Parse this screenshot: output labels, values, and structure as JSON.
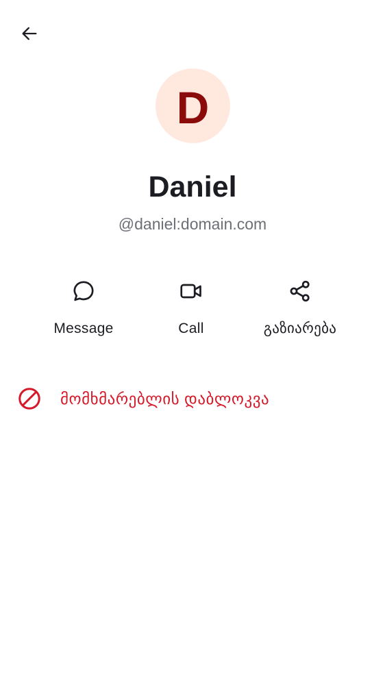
{
  "header": {
    "back_icon": "arrow-left-icon"
  },
  "profile": {
    "avatar_letter": "D",
    "display_name": "Daniel",
    "user_id": "@daniel:domain.com",
    "avatar_bg_color": "#ffe9df",
    "avatar_letter_color": "#8b0a0a"
  },
  "actions": [
    {
      "label": "Message",
      "icon": "chat-bubble-icon"
    },
    {
      "label": "Call",
      "icon": "video-camera-icon"
    },
    {
      "label": "გაზიარება",
      "icon": "share-icon"
    }
  ],
  "block": {
    "label": "მომხმარებლის დაბლოკვა",
    "icon": "block-icon",
    "color": "#d51928"
  }
}
